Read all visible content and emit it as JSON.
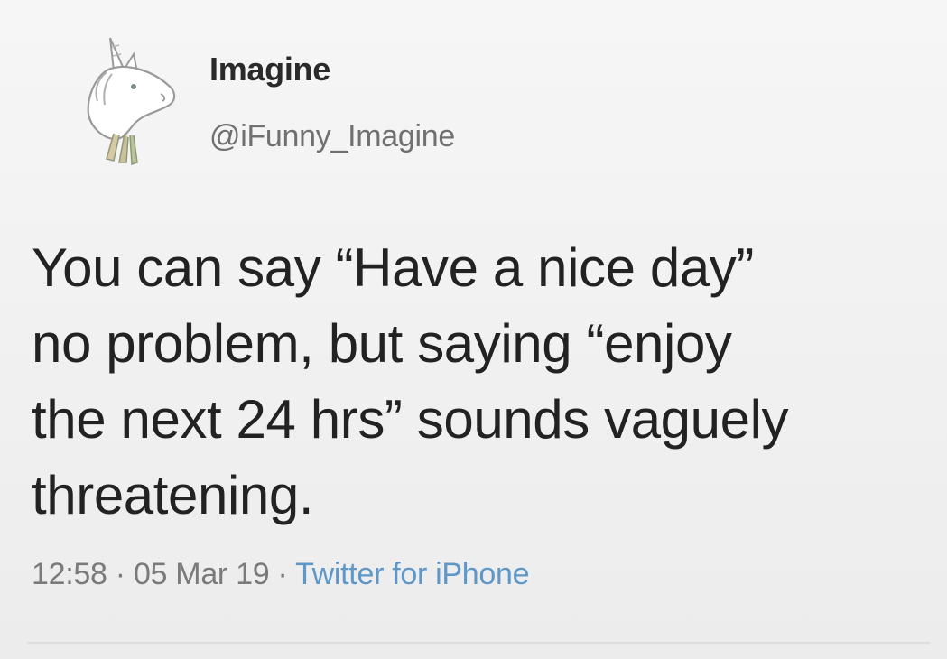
{
  "tweet": {
    "display_name": "Imagine",
    "handle": "@iFunny_Imagine",
    "avatar_icon": "unicorn-sketch-icon",
    "text_lines": [
      "You can say “Have a nice day”",
      "no problem, but saying “enjoy",
      "the next 24 hrs” sounds vaguely",
      "threatening."
    ],
    "time": "12:58",
    "separator": "·",
    "date": "05 Mar 19",
    "source": "Twitter for iPhone",
    "source_color": "#5e97c8"
  }
}
